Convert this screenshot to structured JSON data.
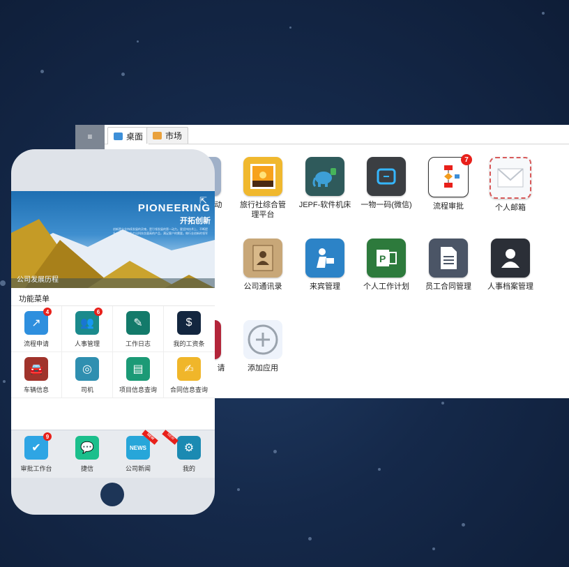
{
  "desktop": {
    "tabs": [
      {
        "label": "桌面",
        "icon": "monitor-icon",
        "active": true
      },
      {
        "label": "市场",
        "icon": "cart-icon",
        "active": false
      }
    ],
    "side_buttons": [
      "≡",
      "›",
      "⌄"
    ],
    "apps": [
      {
        "label": "",
        "icon": "notepad-icon",
        "color": "#f4d59a"
      },
      {
        "label": "动",
        "icon": "puzzle-icon",
        "color": "#9fb0c8"
      },
      {
        "label": "旅行社综合管理平台",
        "icon": "photo-icon",
        "color": "#f0b82e"
      },
      {
        "label": "JEPF-软件机床",
        "icon": "elephant-icon",
        "color": "#2f5a5b"
      },
      {
        "label": "一物一码(微信)",
        "icon": "scan-icon",
        "color": "#3b3e42"
      },
      {
        "label": "流程审批",
        "icon": "flowchart-icon",
        "color": "#ffffff",
        "badge": "7"
      },
      {
        "label": "个人邮箱",
        "icon": "envelope-icon",
        "color": "#f7f9fb"
      },
      {
        "label": "公司通讯录",
        "icon": "address-book-icon",
        "color": "#c8a778"
      },
      {
        "label": "来宾管理",
        "icon": "visitor-icon",
        "color": "#2c83c7"
      },
      {
        "label": "个人工作计划",
        "icon": "project-icon",
        "color": "#2d7a3c"
      },
      {
        "label": "员工合同管理",
        "icon": "document-icon",
        "color": "#4b5566"
      },
      {
        "label": "人事档案管理",
        "icon": "user-icon",
        "color": "#2b2f37"
      },
      {
        "label": "请",
        "icon": "red-app-icon",
        "color": "#b3253a"
      },
      {
        "label": "添加应用",
        "icon": "plus-circle-icon",
        "color": "#eef3fb"
      }
    ]
  },
  "phone": {
    "banner": {
      "title": "PIONEERING",
      "subtitle": "开拓创新",
      "body": "创新是企业持续发展的灵魂，是引领发展的第一动力。要坚持技术上、不断提升产品水平，生产出科技含量高的产品，满足客户的需要。做行业创新的领军人。",
      "caption": "公司发展历程"
    },
    "menu_title": "功能菜单",
    "menu": [
      {
        "label": "流程申请",
        "icon": "chart-icon",
        "color": "#2e8fde",
        "badge": "4"
      },
      {
        "label": "人事管理",
        "icon": "people-icon",
        "color": "#1b8a8c",
        "badge": "6"
      },
      {
        "label": "工作日志",
        "icon": "pen-icon",
        "color": "#137a6a"
      },
      {
        "label": "我的工资条",
        "icon": "money-bag-icon",
        "color": "#13263f"
      },
      {
        "label": "车辆信息",
        "icon": "car-icon",
        "color": "#a0332b"
      },
      {
        "label": "司机",
        "icon": "steering-wheel-icon",
        "color": "#2f8fb0"
      },
      {
        "label": "项目信息查询",
        "icon": "file-icon",
        "color": "#1c9a76"
      },
      {
        "label": "合同信息查询",
        "icon": "edit-icon",
        "color": "#f0b62a"
      }
    ],
    "dock": [
      {
        "label": "审批工作台",
        "icon": "check-icon",
        "color": "#2ea5e4",
        "badge": "9"
      },
      {
        "label": "捷信",
        "icon": "chat-icon",
        "color": "#1bbf8c"
      },
      {
        "label": "公司新闻",
        "icon": "news-icon",
        "color": "#27a6d9",
        "ribbon": "NEW"
      },
      {
        "label": "我的",
        "icon": "gears-icon",
        "color": "#1b8ab2",
        "ribbon": "NEW"
      }
    ]
  }
}
